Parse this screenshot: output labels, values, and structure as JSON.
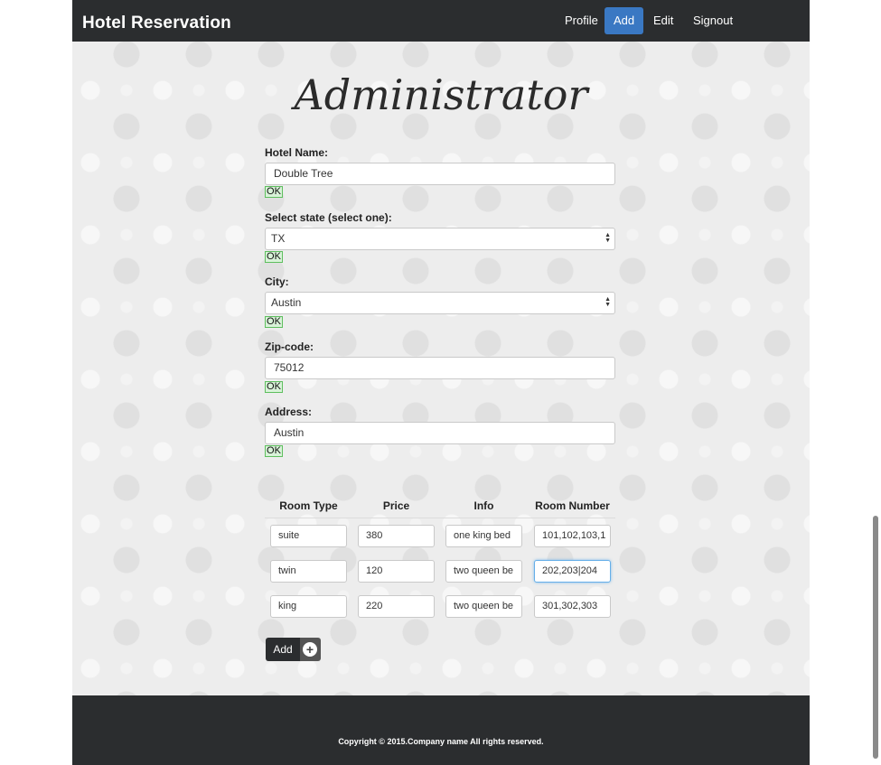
{
  "navbar": {
    "brand": "Hotel Reservation",
    "items": [
      "Profile",
      "Add",
      "Edit",
      "Signout"
    ],
    "active": "Add"
  },
  "page_title": "Administrator",
  "form": {
    "hotel_name": {
      "label": "Hotel Name:",
      "value": "Double Tree",
      "status": "OK"
    },
    "state": {
      "label": "Select state (select one):",
      "value": "TX",
      "status": "OK"
    },
    "city": {
      "label": "City:",
      "value": "Austin",
      "status": "OK"
    },
    "zip": {
      "label": "Zip-code:",
      "value": "75012",
      "status": "OK"
    },
    "address": {
      "label": "Address:",
      "value": "Austin",
      "status": "OK"
    }
  },
  "rooms_table": {
    "headers": [
      "Room Type",
      "Price",
      "Info",
      "Room Number"
    ],
    "rows": [
      [
        "suite",
        "380",
        "one king bed",
        "101,102,103,1"
      ],
      [
        "twin",
        "120",
        "two queen be",
        "202,203|204"
      ],
      [
        "king",
        "220",
        "two queen be",
        "301,302,303"
      ]
    ]
  },
  "add_button": {
    "label": "Add",
    "icon": "plus-circle-icon"
  },
  "footer": {
    "copyright": "Copyright © 2015.Company name All rights reserved."
  },
  "colors": {
    "navbar": "#2b2d2f",
    "active_nav": "#3a78c3",
    "ok_bg": "#d8f2d8",
    "ok_border": "#5fbf5f"
  }
}
